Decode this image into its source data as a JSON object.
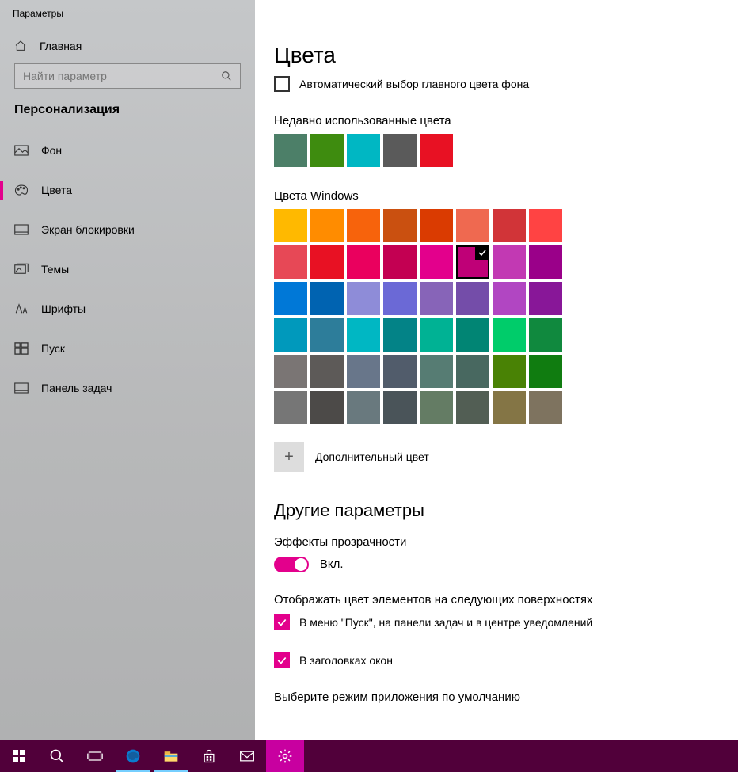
{
  "window_title": "Параметры",
  "home_label": "Главная",
  "search_placeholder": "Найти параметр",
  "section": "Персонализация",
  "nav": [
    {
      "label": "Фон"
    },
    {
      "label": "Цвета"
    },
    {
      "label": "Экран блокировки"
    },
    {
      "label": "Темы"
    },
    {
      "label": "Шрифты"
    },
    {
      "label": "Пуск"
    },
    {
      "label": "Панель задач"
    }
  ],
  "page_title": "Цвета",
  "auto_pick_label": "Автоматический выбор главного цвета фона",
  "recent_title": "Недавно использованные цвета",
  "recent_colors": [
    "#4c7f68",
    "#3e8c0f",
    "#00b7c3",
    "#5a5a5a",
    "#e81123"
  ],
  "windows_title": "Цвета Windows",
  "windows_colors": [
    "#ffb900",
    "#ff8c00",
    "#f7630c",
    "#ca5010",
    "#da3b01",
    "#ef6950",
    "#d13438",
    "#ff4343",
    "#e74856",
    "#e81123",
    "#ea005e",
    "#c30052",
    "#e3008c",
    "#bf0077",
    "#c239b3",
    "#9a0089",
    "#0078d7",
    "#0063b1",
    "#8e8cd8",
    "#6b69d6",
    "#8764b8",
    "#744da9",
    "#b146c2",
    "#881798",
    "#0099bc",
    "#2d7d9a",
    "#00b7c3",
    "#038387",
    "#00b294",
    "#018574",
    "#00cc6a",
    "#10893e",
    "#7a7574",
    "#5d5a58",
    "#68768a",
    "#515c6b",
    "#567c73",
    "#486860",
    "#498205",
    "#107c10",
    "#767676",
    "#4c4a48",
    "#69797e",
    "#4a5459",
    "#647c64",
    "#525e54",
    "#847545",
    "#7e735f"
  ],
  "selected_color_index": 13,
  "custom_color_label": "Дополнительный цвет",
  "other_section": "Другие параметры",
  "transparency_label": "Эффекты прозрачности",
  "toggle_on": "Вкл.",
  "surfaces_label": "Отображать цвет элементов на следующих поверхностях",
  "surface_opt1": "В меню \"Пуск\", на панели задач и в центре уведомлений",
  "surface_opt2": "В заголовках окон",
  "app_mode_label": "Выберите режим приложения по умолчанию"
}
